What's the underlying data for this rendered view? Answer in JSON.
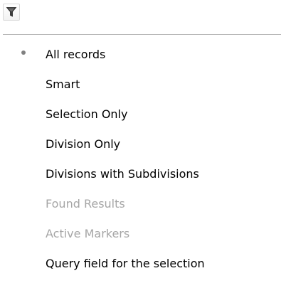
{
  "toolbar": {
    "filter_icon": "filter-funnel-icon"
  },
  "menu": {
    "items": [
      {
        "label": "All records",
        "selected": true,
        "enabled": true
      },
      {
        "label": "Smart",
        "selected": false,
        "enabled": true
      },
      {
        "label": "Selection Only",
        "selected": false,
        "enabled": true
      },
      {
        "label": "Division Only",
        "selected": false,
        "enabled": true
      },
      {
        "label": "Divisions with Subdivisions",
        "selected": false,
        "enabled": true
      },
      {
        "label": "Found Results",
        "selected": false,
        "enabled": false
      },
      {
        "label": "Active Markers",
        "selected": false,
        "enabled": false
      },
      {
        "label": "Query field for the selection",
        "selected": false,
        "enabled": true
      }
    ]
  }
}
